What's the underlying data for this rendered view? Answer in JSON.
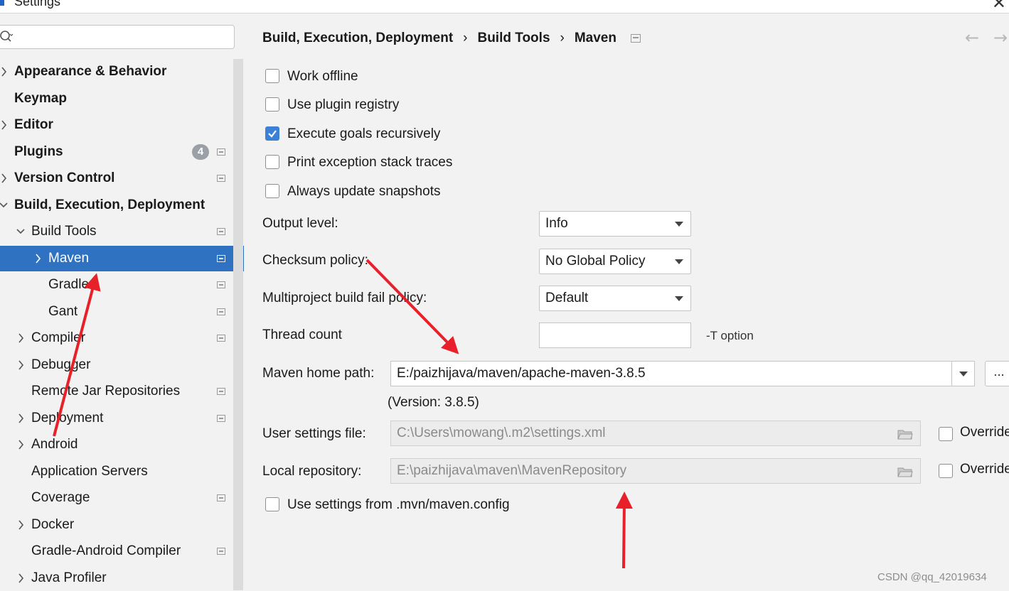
{
  "window": {
    "title": "Settings"
  },
  "search": {
    "placeholder": ""
  },
  "sidebar": {
    "items": [
      {
        "label": "Appearance & Behavior",
        "indent": 0,
        "chevron": "right",
        "bold": true,
        "badge": "",
        "icon": false
      },
      {
        "label": "Keymap",
        "indent": 0,
        "chevron": "",
        "bold": true,
        "badge": "",
        "icon": false
      },
      {
        "label": "Editor",
        "indent": 0,
        "chevron": "right",
        "bold": true,
        "badge": "",
        "icon": false
      },
      {
        "label": "Plugins",
        "indent": 0,
        "chevron": "",
        "bold": true,
        "badge": "4",
        "icon": true
      },
      {
        "label": "Version Control",
        "indent": 0,
        "chevron": "right",
        "bold": true,
        "badge": "",
        "icon": true
      },
      {
        "label": "Build, Execution, Deployment",
        "indent": 0,
        "chevron": "down",
        "bold": true,
        "badge": "",
        "icon": false
      },
      {
        "label": "Build Tools",
        "indent": 1,
        "chevron": "down",
        "bold": false,
        "badge": "",
        "icon": true
      },
      {
        "label": "Maven",
        "indent": 2,
        "chevron": "right",
        "bold": false,
        "badge": "",
        "icon": true,
        "selected": true
      },
      {
        "label": "Gradle",
        "indent": 2,
        "chevron": "",
        "bold": false,
        "badge": "",
        "icon": true
      },
      {
        "label": "Gant",
        "indent": 2,
        "chevron": "",
        "bold": false,
        "badge": "",
        "icon": true
      },
      {
        "label": "Compiler",
        "indent": 1,
        "chevron": "right",
        "bold": false,
        "badge": "",
        "icon": true
      },
      {
        "label": "Debugger",
        "indent": 1,
        "chevron": "right",
        "bold": false,
        "badge": "",
        "icon": false
      },
      {
        "label": "Remote Jar Repositories",
        "indent": 1,
        "chevron": "",
        "bold": false,
        "badge": "",
        "icon": true
      },
      {
        "label": "Deployment",
        "indent": 1,
        "chevron": "right",
        "bold": false,
        "badge": "",
        "icon": true
      },
      {
        "label": "Android",
        "indent": 1,
        "chevron": "right",
        "bold": false,
        "badge": "",
        "icon": false
      },
      {
        "label": "Application Servers",
        "indent": 1,
        "chevron": "",
        "bold": false,
        "badge": "",
        "icon": false
      },
      {
        "label": "Coverage",
        "indent": 1,
        "chevron": "",
        "bold": false,
        "badge": "",
        "icon": true
      },
      {
        "label": "Docker",
        "indent": 1,
        "chevron": "right",
        "bold": false,
        "badge": "",
        "icon": false
      },
      {
        "label": "Gradle-Android Compiler",
        "indent": 1,
        "chevron": "",
        "bold": false,
        "badge": "",
        "icon": true
      },
      {
        "label": "Java Profiler",
        "indent": 1,
        "chevron": "right",
        "bold": false,
        "badge": "",
        "icon": false
      }
    ]
  },
  "breadcrumb": {
    "parts": [
      "Build, Execution, Deployment",
      "Build Tools",
      "Maven"
    ],
    "separator": "›"
  },
  "nav": {
    "back": "←",
    "forward": "→"
  },
  "options": [
    {
      "label": "Work offline",
      "checked": false
    },
    {
      "label": "Use plugin registry",
      "checked": false
    },
    {
      "label": "Execute goals recursively",
      "checked": true
    },
    {
      "label": "Print exception stack traces",
      "checked": false
    },
    {
      "label": "Always update snapshots",
      "checked": false
    }
  ],
  "output_level": {
    "label": "Output level:",
    "value": "Info"
  },
  "checksum_policy": {
    "label": "Checksum policy:",
    "value": "No Global Policy"
  },
  "multiproject": {
    "label": "Multiproject build fail policy:",
    "value": "Default"
  },
  "thread_count": {
    "label": "Thread count",
    "value": "",
    "hint": "-T option"
  },
  "maven_home": {
    "label": "Maven home path:",
    "value": "E:/paizhijava/maven/apache-maven-3.8.5",
    "browse": "...",
    "version": "(Version: 3.8.5)"
  },
  "user_settings": {
    "label": "User settings file:",
    "value": "C:\\Users\\mowang\\.m2\\settings.xml",
    "override": "Override",
    "override_checked": false
  },
  "local_repo": {
    "label": "Local repository:",
    "value": "E:\\paizhijava\\maven\\MavenRepository",
    "override": "Override",
    "override_checked": false
  },
  "mvn_config": {
    "label": "Use settings from .mvn/maven.config",
    "checked": false
  },
  "colors": {
    "accent": "#2f72c2",
    "checkbox_checked": "#3b82d6",
    "annotation": "#e8202a"
  },
  "watermark": "CSDN @qq_42019634"
}
